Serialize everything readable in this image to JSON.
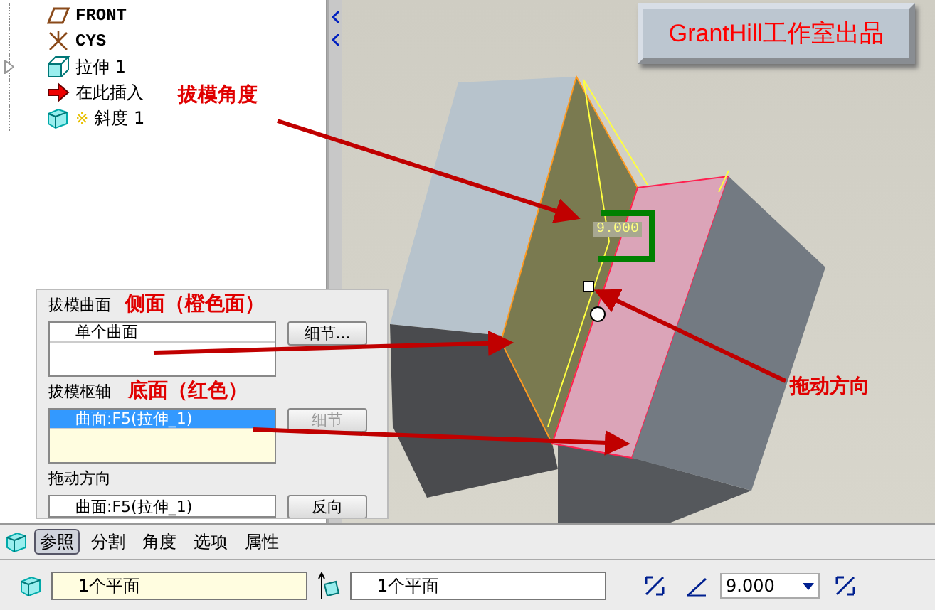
{
  "model_tree": {
    "items": [
      {
        "label": "FRONT",
        "kind": "plane",
        "expandable": false
      },
      {
        "label": "CYS",
        "kind": "csys",
        "expandable": false
      },
      {
        "label": "拉伸 1",
        "kind": "extrude",
        "expandable": true
      },
      {
        "label": "在此插入",
        "kind": "insert",
        "expandable": false
      },
      {
        "label": "斜度 1",
        "kind": "draft",
        "expandable": false,
        "marker": "※"
      }
    ]
  },
  "banner": {
    "text": "GrantHill工作室出品"
  },
  "viewport": {
    "dimension": "9.000"
  },
  "annotations": [
    {
      "kind": "draft_angle",
      "text": "拔模角度"
    },
    {
      "kind": "side_surface",
      "text": "侧面（橙色面）"
    },
    {
      "kind": "bottom_surface",
      "text": "底面（红色）"
    },
    {
      "kind": "drag_direction",
      "text": "拖动方向"
    }
  ],
  "references_panel": {
    "draft_surfaces": {
      "label": "拔模曲面",
      "items": [
        {
          "text": "单个曲面",
          "selected": false
        }
      ],
      "button": {
        "label": "细节...",
        "disabled": false
      }
    },
    "draft_hinges": {
      "label": "拔模枢轴",
      "items": [
        {
          "text": "曲面:F5(拉伸_1)",
          "selected": true
        }
      ],
      "button": {
        "label": "细节",
        "disabled": true
      }
    },
    "drag_direction": {
      "label": "拖动方向",
      "value": "曲面:F5(拉伸_1)",
      "button": "反向"
    }
  },
  "dashboard": {
    "tabs": [
      {
        "label": "参照",
        "selected": true
      },
      {
        "label": "分割",
        "selected": false
      },
      {
        "label": "角度",
        "selected": false
      },
      {
        "label": "选项",
        "selected": false
      },
      {
        "label": "属性",
        "selected": false
      }
    ],
    "fields": [
      {
        "value": "1个平面",
        "highlighted": true
      },
      {
        "value": "1个平面",
        "highlighted": false
      }
    ],
    "angle": {
      "value": "9.000"
    }
  }
}
